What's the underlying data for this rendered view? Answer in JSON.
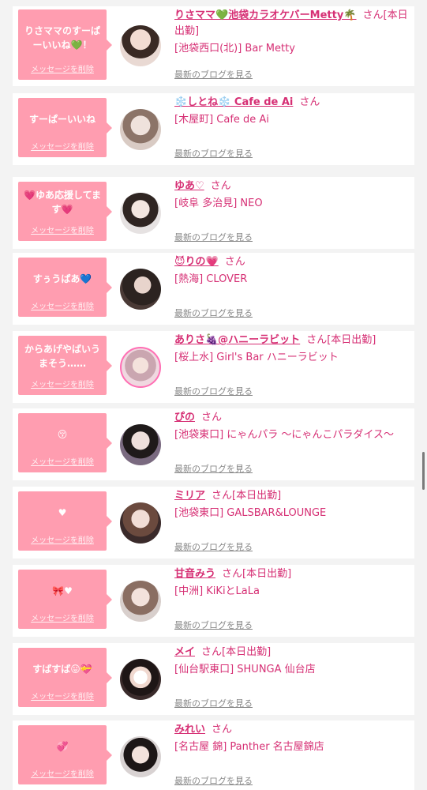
{
  "delete_label": "メッセージを削除",
  "blog_label": "最新のブログを見る",
  "colors": {
    "accent": "#d62f74",
    "bubble": "#ff9db0",
    "card": "#ffffff",
    "bg": "#f3f3f3"
  },
  "items": [
    {
      "message": "りさママのすーぱーいいね💚！",
      "name": "りさママ💚池袋カラオケバーMetty🌴",
      "suffix": "さん[本日出勤]",
      "shop": "[池袋西口(北)] Bar Metty"
    },
    {
      "message": "すーぱーいいね",
      "name": "❄️しとね❄️ Cafe de Ai",
      "suffix": "さん",
      "shop": "[木屋町] Cafe de Ai"
    },
    {
      "message": "💗ゆあ応援してます💗",
      "name": "ゆあ♡",
      "suffix": "さん",
      "shop": "[岐阜 多治見] NEO"
    },
    {
      "message": "すぅうぱあ💙",
      "name": "😈りの💗",
      "suffix": "さん",
      "shop": "[熱海] CLOVER"
    },
    {
      "message": "からあげやばいうまそう……",
      "name": "ありさ🍇@ハニーラビット",
      "suffix": "さん[本日出勤]",
      "shop": "[桜上水] Girl's Bar ハニーラビット"
    },
    {
      "message": "😚",
      "name": "ぴの",
      "suffix": "さん",
      "shop": "[池袋東口] にゃんパラ 〜にゃんこパラダイス〜"
    },
    {
      "message": "♥",
      "name": "ミリア",
      "suffix": "さん[本日出勤]",
      "shop": "[池袋東口] GALSBAR&LOUNGE"
    },
    {
      "message": "🎀♥",
      "name": "甘音みう",
      "suffix": "さん[本日出勤]",
      "shop": "[中洲] KiKiとLaLa"
    },
    {
      "message": "すばすば😛💝",
      "name": "メイ",
      "suffix": "さん[本日出勤]",
      "shop": "[仙台駅東口] SHUNGA 仙台店"
    },
    {
      "message": "💞",
      "name": "みれい",
      "suffix": "さん",
      "shop": "[名古屋 錦] Panther 名古屋錦店"
    }
  ]
}
